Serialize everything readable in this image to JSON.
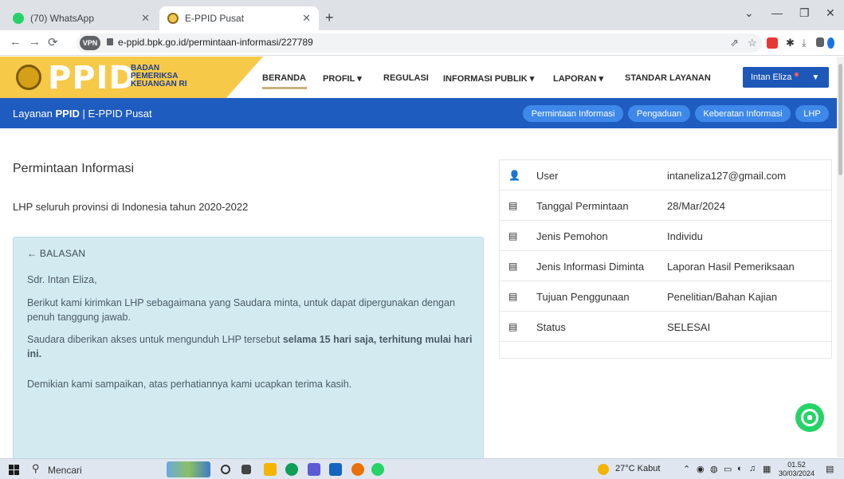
{
  "browser": {
    "tabs": [
      {
        "label": "(70) WhatsApp"
      },
      {
        "label": "E-PPID Pusat"
      }
    ],
    "url": "e-ppid.bpk.go.id/permintaan-informasi/227789",
    "ext_badge": "VPN"
  },
  "site": {
    "logo_text": "PPID",
    "logo_sub": [
      "BADAN",
      "PEMERIKSA",
      "KEUANGAN RI"
    ],
    "nav": [
      "BERANDA",
      "PROFIL ▾",
      "REGULASI",
      "INFORMASI PUBLIK ▾",
      "LAPORAN ▾",
      "STANDAR LAYANAN"
    ],
    "user_name": "Intan Eliza",
    "service_prefix": "Layanan ",
    "service_bold": "PPID",
    "service_suffix": " | E-PPID Pusat",
    "pills": [
      "Permintaan Informasi",
      "Pengaduan",
      "Keberatan Informasi",
      "LHP"
    ]
  },
  "main": {
    "title": "Permintaan Informasi",
    "request": "LHP seluruh provinsi di Indonesia tahun 2020-2022",
    "reply": {
      "heading": "← BALASAN",
      "greeting": "Sdr. Intan Eliza,",
      "p1": "Berikut kami kirimkan LHP sebagaimana yang Saudara minta, untuk dapat dipergunakan dengan penuh tanggung jawab.",
      "p2_pre": "Saudara diberikan akses untuk mengunduh LHP tersebut ",
      "p2_bold": "selama 15 hari saja, terhitung mulai hari ini.",
      "p3": "Demikian kami sampaikan, atas perhatiannya kami ucapkan terima kasih."
    }
  },
  "info": {
    "rows": [
      {
        "icon": "user-icon",
        "glyph": "👤",
        "label": "User",
        "value": "intaneliza127@gmail.com"
      },
      {
        "icon": "document-icon",
        "glyph": "▤",
        "label": "Tanggal Permintaan",
        "value": "28/Mar/2024"
      },
      {
        "icon": "document-icon",
        "glyph": "▤",
        "label": "Jenis Pemohon",
        "value": "Individu"
      },
      {
        "icon": "document-icon",
        "glyph": "▤",
        "label": "Jenis Informasi Diminta",
        "value": "Laporan Hasil Pemeriksaan"
      },
      {
        "icon": "document-icon",
        "glyph": "▤",
        "label": "Tujuan Penggunaan",
        "value": "Penelitian/Bahan Kajian"
      },
      {
        "icon": "document-icon",
        "glyph": "▤",
        "label": "Status",
        "value": "SELESAI"
      }
    ]
  },
  "taskbar": {
    "search": "Mencari",
    "weather": "27°C  Kabut",
    "time": "01.52",
    "date": "30/03/2024"
  }
}
